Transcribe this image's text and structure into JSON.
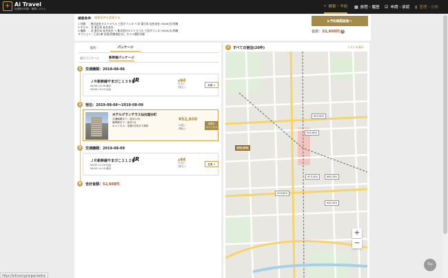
{
  "app": {
    "name": "Ai Travel",
    "tagline": "出張旅行手配・管理システム"
  },
  "nav": [
    {
      "label": "検索・予約",
      "icon": "search-icon",
      "active": true
    },
    {
      "label": "旅程・履歴",
      "icon": "calendar-icon",
      "active": false
    },
    {
      "label": "申請・承認",
      "icon": "check-icon",
      "active": false
    },
    {
      "label": "管理・分析",
      "icon": "chart-icon",
      "active": false
    }
  ],
  "conditions": {
    "title": "検索条件",
    "change_link": "検索条件を変更する",
    "rows": [
      "1.往路　：株式会社ＡＩトラベル 三田オフィス → 洋 東日本 仙台支社 09/06(日)到着",
      "2.ホテル：洋 東日本 仙台支社",
      "3.復路　：洋 東日本 仙台支社 → 株式会社ＡＩトラベル 三田オフィス 09/09(水)到着",
      "オプション：乙名1席 出発/到着指定なし ホテル選択可能"
    ],
    "apply_button": "▶予約確認画面へ",
    "total_label": "合計：",
    "total_amount": "52,600円"
  },
  "tabs": {
    "individual": "個別",
    "package": "パッケージ"
  },
  "subtabs": {
    "existing": "既行パッケージ",
    "new": "新幹線パッケージ"
  },
  "steps": [
    {
      "num": "1",
      "label": "交通機関：2019-08-06"
    },
    {
      "num": "2",
      "label": "宿泊：2019-08-06〜2019-08-09"
    },
    {
      "num": "3",
      "label": "交通機関：2019-08-09"
    }
  ],
  "trains": [
    {
      "name": "ＪＲ新幹線やまびこ１３９号",
      "logo": "JR",
      "depart": "08/06 13:08 東京",
      "arrive": "08/06 15:09 仙台",
      "class_label": "▲普通",
      "seat_label": "(1名)",
      "class_note": "(禁止)",
      "button": "変更 >"
    },
    {
      "name": "ＪＲ新幹線やまびこ２１２号",
      "logo": "JR",
      "depart": "08/09 12:08 仙台",
      "arrive": "08/09 14:16 東京",
      "class_label": "▲普通",
      "seat_label": "(1名)",
      "class_note": "(禁止)",
      "button": "変更 >"
    }
  ],
  "hotel": {
    "name": "ホテルグランテラス仙台国分町",
    "lines": [
      "交通機関まで：徒歩10分",
      "最寄駅まで：徒歩1分",
      "キャンセル：全額1日前まで無料"
    ],
    "price": "¥52,600",
    "note1": "(1名)",
    "note2": "(禁止)",
    "cancel_button_1": "変更を",
    "cancel_button_2": "キャンセル"
  },
  "grand_total": {
    "label": "合計金額：",
    "amount": "52,600円"
  },
  "map": {
    "num": "2",
    "title": "すべての宿泊(20件)",
    "list_link": "リストを表示",
    "pins": [
      "¥52,600",
      "¥53,500",
      "¥52,600",
      "¥73,300",
      "¥63,780",
      "¥76,600",
      "¥42,300"
    ],
    "zoom_in": "+",
    "zoom_out": "−"
  },
  "scroll_top_label": "Top",
  "status_url": "https://aitravel.jp/organization"
}
